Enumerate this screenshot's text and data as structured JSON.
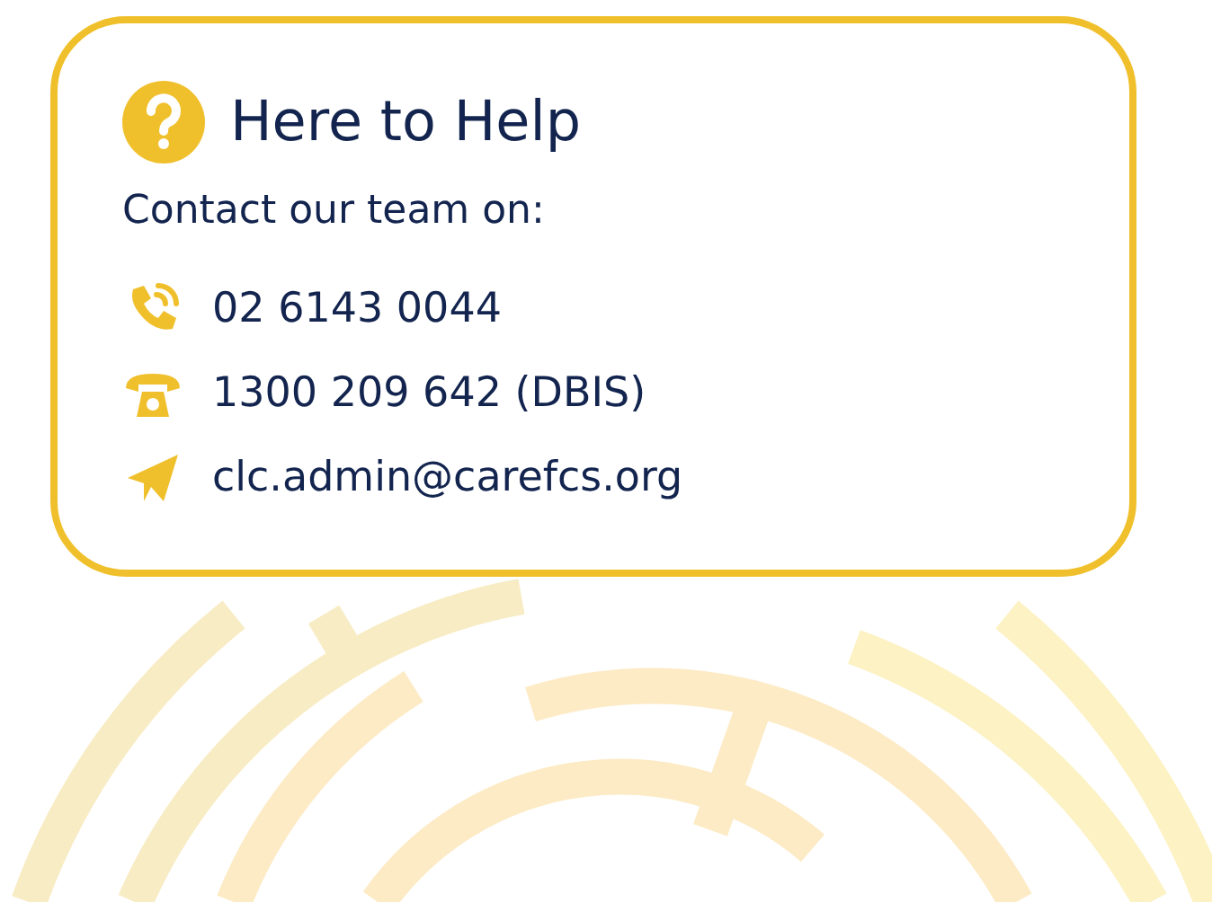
{
  "card": {
    "title": "Here to Help",
    "intro": "Contact our team on:",
    "contacts": [
      {
        "kind": "phone",
        "text": "02 6143 0044"
      },
      {
        "kind": "telephone",
        "text": "1300 209 642 (DBIS)"
      },
      {
        "kind": "email",
        "text": "clc.admin@carefcs.org"
      }
    ]
  }
}
